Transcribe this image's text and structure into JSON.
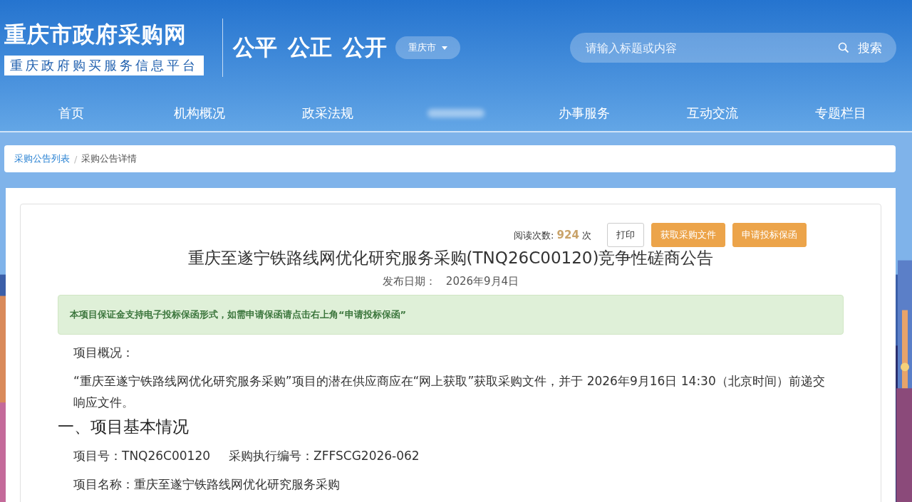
{
  "header": {
    "site_title": "重庆市政府采购网",
    "site_subtitle": "重庆政府购买服务信息平台",
    "slogan": "公平 公正 公开",
    "region_select": {
      "value": "重庆市"
    },
    "search": {
      "placeholder": "请输入标题或内容",
      "button": "搜索"
    }
  },
  "nav": [
    {
      "kind": "text",
      "label": "首页"
    },
    {
      "kind": "text",
      "label": "机构概况"
    },
    {
      "kind": "text",
      "label": "政采法规"
    },
    {
      "kind": "blurred"
    },
    {
      "kind": "text",
      "label": "办事服务"
    },
    {
      "kind": "text",
      "label": "互动交流"
    },
    {
      "kind": "text",
      "label": "专题栏目"
    }
  ],
  "breadcrumb": [
    {
      "label": "采购公告列表",
      "link": true,
      "separator": "/"
    },
    {
      "label": "采购公告详情",
      "link": false
    }
  ],
  "article": {
    "views_label": "阅读次数:",
    "views": "924",
    "views_unit": "次",
    "actions": [
      {
        "label": "打印",
        "kind": "plain"
      },
      {
        "label": "获取采购文件",
        "kind": "primary"
      },
      {
        "label": "申请投标保函",
        "kind": "primary"
      }
    ],
    "title": "重庆至遂宁铁路线网优化研究服务采购(TNQ26C00120)竞争性磋商公告",
    "date_label": "发布日期：",
    "date": "2026年9月4日",
    "notice": "本项目保证金支持电子投标保函形式，如需申请保函请点击右上角“申请投标保函”",
    "blocks": [
      {
        "kind": "para",
        "text": "项目概况："
      },
      {
        "kind": "para",
        "text": "“重庆至遂宁铁路线网优化研究服务采购”项目的潜在供应商应在“网上获取”获取采购文件，并于 2026年9月16日 14:30（北京时间）前递交响应文件。"
      },
      {
        "kind": "heading",
        "text": "一、项目基本情况"
      },
      {
        "kind": "fields",
        "items": [
          "项目号：TNQ26C00120",
          "采购执行编号：ZFFSCG2026-062"
        ]
      },
      {
        "kind": "para",
        "text": "项目名称：重庆至遂宁铁路线网优化研究服务采购"
      }
    ]
  }
}
